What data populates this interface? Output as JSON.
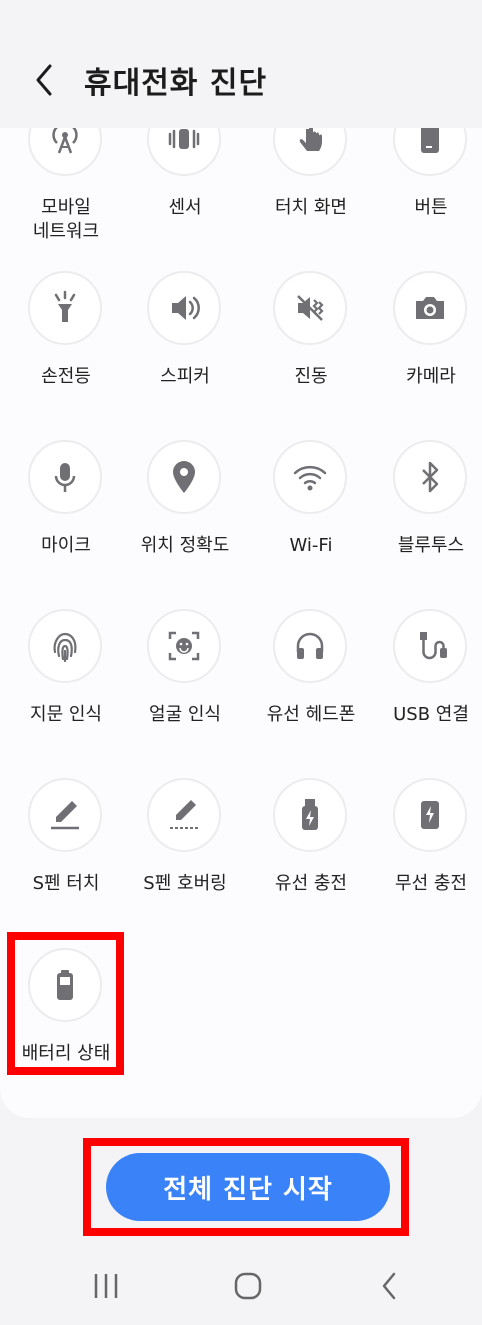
{
  "header": {
    "title": "휴대전화 진단"
  },
  "colors": {
    "accent": "#3a82f7",
    "icon_gray": "#6f6f74",
    "highlight": "#ff0000"
  },
  "items": [
    {
      "label": "모바일\n네트워크",
      "icon": "antenna-icon"
    },
    {
      "label": "센서",
      "icon": "sensor-icon"
    },
    {
      "label": "터치 화면",
      "icon": "touch-icon"
    },
    {
      "label": "버튼",
      "icon": "phone-button-icon"
    },
    {
      "label": "손전등",
      "icon": "flashlight-icon"
    },
    {
      "label": "스피커",
      "icon": "speaker-icon"
    },
    {
      "label": "진동",
      "icon": "vibration-icon"
    },
    {
      "label": "카메라",
      "icon": "camera-icon"
    },
    {
      "label": "마이크",
      "icon": "mic-icon"
    },
    {
      "label": "위치 정확도",
      "icon": "location-icon"
    },
    {
      "label": "Wi-Fi",
      "icon": "wifi-icon"
    },
    {
      "label": "블루투스",
      "icon": "bluetooth-icon"
    },
    {
      "label": "지문 인식",
      "icon": "fingerprint-icon"
    },
    {
      "label": "얼굴 인식",
      "icon": "face-icon"
    },
    {
      "label": "유선 헤드폰",
      "icon": "headphones-icon"
    },
    {
      "label": "USB 연결",
      "icon": "usb-cable-icon"
    },
    {
      "label": "S펜 터치",
      "icon": "spen-icon"
    },
    {
      "label": "S펜 호버링",
      "icon": "spen-hover-icon"
    },
    {
      "label": "유선 충전",
      "icon": "usb-charge-icon"
    },
    {
      "label": "무선 충전",
      "icon": "wireless-charge-icon"
    },
    {
      "label": "배터리 상태",
      "icon": "battery-icon"
    }
  ],
  "actions": {
    "start_all": "전체 진단 시작"
  }
}
